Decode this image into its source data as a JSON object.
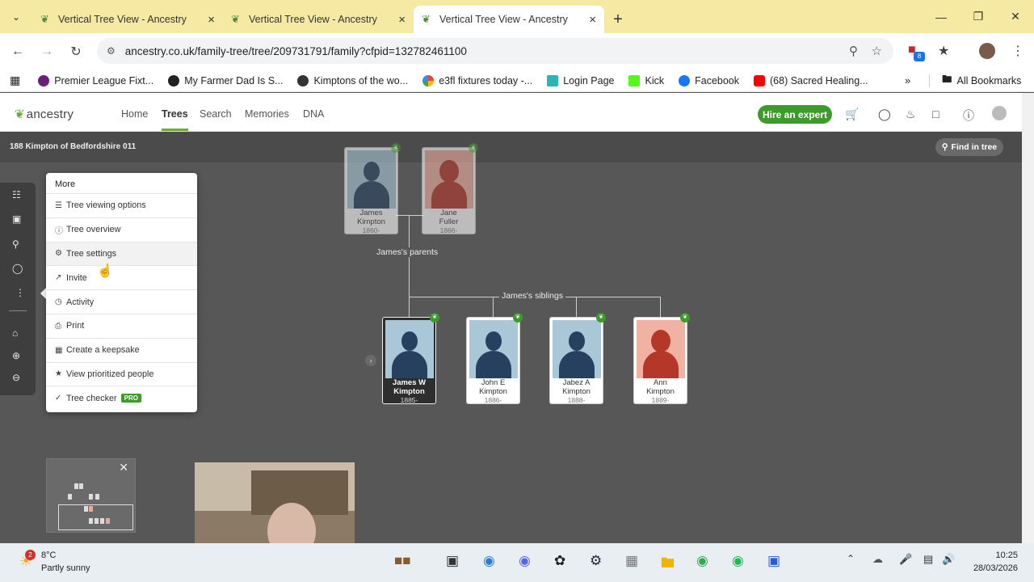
{
  "browser": {
    "tabs": [
      {
        "title": "Vertical Tree View - Ancestry"
      },
      {
        "title": "Vertical Tree View - Ancestry"
      },
      {
        "title": "Vertical Tree View - Ancestry"
      }
    ],
    "url": "ancestry.co.uk/family-tree/tree/209731791/family?cfpid=132782461100",
    "extension_badge": "8",
    "bookmarks": [
      {
        "label": "Premier League Fixt...",
        "color": "#6b1f7a"
      },
      {
        "label": "My Farmer Dad Is S...",
        "color": "#222222"
      },
      {
        "label": "Kimptons of the wo...",
        "color": "#333333"
      },
      {
        "label": "e3fl fixtures today -...",
        "color": "#4285f4"
      },
      {
        "label": "Login Page",
        "color": "#2bb5b5"
      },
      {
        "label": "Kick",
        "color": "#53fc18"
      },
      {
        "label": "Facebook",
        "color": "#1877f2"
      },
      {
        "label": "(68) Sacred Healing...",
        "color": "#ff0000"
      }
    ],
    "all_bookmarks": "All Bookmarks"
  },
  "header": {
    "logo": "ancestry",
    "nav": [
      "Home",
      "Trees",
      "Search",
      "Memories",
      "DNA"
    ],
    "hire_button": "Hire an expert"
  },
  "tree_bar": {
    "tree_name": "188 Kimpton of Bedfordshire 011",
    "find_button": "Find in tree"
  },
  "menu": {
    "title": "More",
    "items": [
      {
        "label": "Tree viewing options",
        "icon": "layers-icon"
      },
      {
        "label": "Tree overview",
        "icon": "info-icon"
      },
      {
        "label": "Tree settings",
        "icon": "gear-icon"
      },
      {
        "label": "Invite",
        "icon": "share-icon"
      },
      {
        "label": "Activity",
        "icon": "clock-icon"
      },
      {
        "label": "Print",
        "icon": "print-icon"
      },
      {
        "label": "Create a keepsake",
        "icon": "gift-icon"
      },
      {
        "label": "View prioritized people",
        "icon": "star-icon"
      },
      {
        "label": "Tree checker",
        "icon": "check-icon",
        "badge": "PRO"
      }
    ]
  },
  "tree": {
    "parents_label": "James's parents",
    "siblings_label": "James's siblings",
    "parents": [
      {
        "first": "James",
        "last": "Kimpton",
        "years": "1860-",
        "gender": "male"
      },
      {
        "first": "Jane",
        "last": "Fuller",
        "years": "1866-",
        "gender": "female"
      }
    ],
    "children": [
      {
        "first": "James W",
        "last": "Kimpton",
        "years": "1885-",
        "gender": "male"
      },
      {
        "first": "John E",
        "last": "Kimpton",
        "years": "1886-",
        "gender": "male"
      },
      {
        "first": "Jabez A",
        "last": "Kimpton",
        "years": "1888-",
        "gender": "male"
      },
      {
        "first": "Ann",
        "last": "Kimpton",
        "years": "1889-",
        "gender": "female"
      }
    ]
  },
  "taskbar": {
    "weather_temp": "8°C",
    "weather_desc": "Partly sunny",
    "weather_badge": "2",
    "time": "10:25",
    "date": "28/03/2026"
  }
}
